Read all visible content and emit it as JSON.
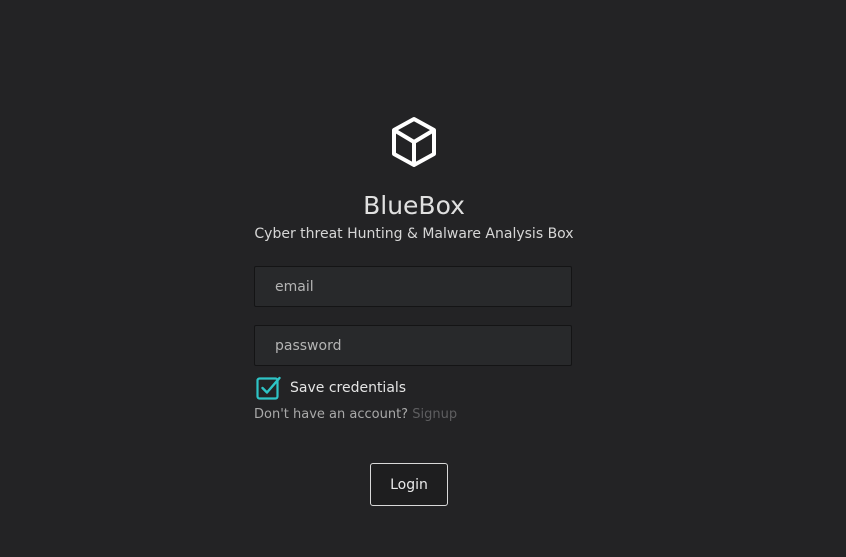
{
  "logo": {
    "icon": "cube-icon"
  },
  "app": {
    "title": "BlueBox",
    "subtitle": "Cyber threat Hunting & Malware Analysis Box"
  },
  "form": {
    "email_placeholder": "email",
    "password_placeholder": "password",
    "remember_label": "Save credentials",
    "remember_checked": true,
    "signup_prompt": "Don't have an account?",
    "signup_link": "Signup",
    "login_label": "Login"
  },
  "colors": {
    "background": "#232325",
    "accent": "#2ec4c6"
  }
}
